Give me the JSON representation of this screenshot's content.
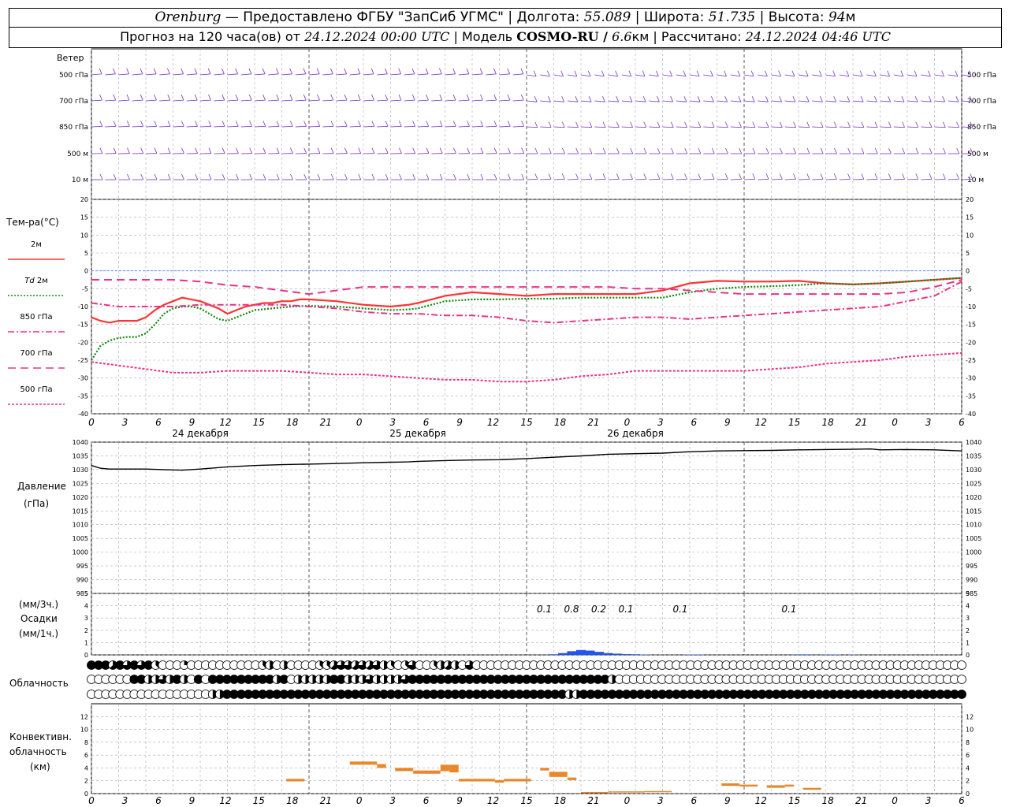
{
  "header": {
    "station": "Orenburg",
    "provider": "Предоставлено ФГБУ \"ЗапСиб УГМС\"",
    "lon_label": "Долгота:",
    "lon": "55.089",
    "lat_label": "Широта:",
    "lat": "51.735",
    "alt_label": "Высота:",
    "alt": "94",
    "alt_unit": "м",
    "forecast_text": "Прогноз на 120 часа(ов) от",
    "forecast_time": "24.12.2024 00:00 UTC",
    "model_label": "Модель",
    "model": "COSMO-RU /",
    "resolution": "6.6",
    "resolution_unit": "км",
    "calc_label": "Рассчитано:",
    "calc_time": "24.12.2024 04:46 UTC"
  },
  "labels": {
    "wind": "Ветер",
    "temp": "Тем-ра(°C)",
    "pressure": "Давление",
    "pressure_unit": "(гПа)",
    "precip_3h": "(мм/3ч.)",
    "precip": "Осадки",
    "precip_1h": "(мм/1ч.)",
    "cloud": "Облачность",
    "conv1": "Конвективн.",
    "conv2": "облачность",
    "conv3": "(км)"
  },
  "wind_levels": [
    "500 гПа",
    "700 гПа",
    "850 гПа",
    "500 м",
    "10 м"
  ],
  "legend": [
    {
      "label": "2м",
      "prefix": "",
      "color": "#ff3333",
      "dash": ""
    },
    {
      "label": "2м",
      "prefix": "Td",
      "color": "#118811",
      "dash": "2,2"
    },
    {
      "label": "850 гПа",
      "prefix": "",
      "color": "#e8338a",
      "dash": "8,3,2,3"
    },
    {
      "label": "700 гПа",
      "prefix": "",
      "color": "#e8338a",
      "dash": "10,6"
    },
    {
      "label": "500 гПа",
      "prefix": "",
      "color": "#e8338a",
      "dash": "3,2"
    }
  ],
  "dates": [
    "24 декабря",
    "25 декабря",
    "26 декабря"
  ],
  "hour_ticks": [
    "0",
    "3",
    "6",
    "9",
    "12",
    "15",
    "18",
    "21",
    "0",
    "3",
    "6",
    "9",
    "12",
    "15",
    "18",
    "21",
    "0",
    "3",
    "6",
    "9",
    "12",
    "15",
    "18",
    "21",
    "0",
    "3",
    "6"
  ],
  "precip_labels": [
    {
      "h": 51,
      "text": "0.1"
    },
    {
      "h": 54,
      "text": "0.8"
    },
    {
      "h": 57,
      "text": "0.2"
    },
    {
      "h": 60,
      "text": "0.1"
    },
    {
      "h": 66,
      "text": "0.1"
    },
    {
      "h": 78,
      "text": "0.1"
    }
  ],
  "colors": {
    "wind": "#7733cc",
    "t2m": "#ff3333",
    "td": "#118811",
    "upper": "#e8338a",
    "pressure": "#000000",
    "precip": "#2255ee",
    "conv": "#e8882a",
    "zero_line": "#5577ff"
  },
  "chart_data": [
    {
      "type": "line",
      "title": "Тем-ра(°C)",
      "x_unit": "hours from 24.12.2024 00:00 UTC",
      "ylim": [
        -40,
        20
      ],
      "yticks": [
        20,
        15,
        10,
        5,
        0,
        -5,
        -10,
        -15,
        -20,
        -25,
        -30,
        -35,
        -40
      ],
      "series": [
        {
          "name": "2м",
          "x": [
            0,
            1,
            2,
            3,
            4,
            5,
            6,
            7,
            8,
            9,
            10,
            11,
            12,
            13,
            14,
            15,
            16,
            17,
            18,
            19,
            20,
            21,
            22,
            23,
            24,
            27,
            30,
            33,
            35,
            36,
            39,
            42,
            45,
            48,
            51,
            54,
            57,
            60,
            63,
            66,
            69,
            72,
            75,
            78,
            81,
            84,
            87,
            90,
            93,
            96
          ],
          "y": [
            -13,
            -14,
            -14.5,
            -14,
            -14,
            -14,
            -13,
            -11,
            -9.5,
            -8.5,
            -7.5,
            -8,
            -8.5,
            -9.5,
            -10.5,
            -12,
            -11,
            -10,
            -9.5,
            -9,
            -9,
            -8.5,
            -8.5,
            -8,
            -8,
            -8.5,
            -9.5,
            -10,
            -9.5,
            -9,
            -7,
            -6,
            -6.5,
            -7,
            -6.5,
            -6.5,
            -6.5,
            -6.5,
            -5.5,
            -3.5,
            -2.8,
            -3,
            -3,
            -2.8,
            -3.5,
            -3.8,
            -3.5,
            -3,
            -2.5,
            -2
          ]
        },
        {
          "name": "Td 2м",
          "x": [
            0,
            1,
            2,
            3,
            4,
            5,
            6,
            7,
            8,
            9,
            10,
            11,
            12,
            13,
            14,
            15,
            16,
            17,
            18,
            20,
            22,
            24,
            27,
            30,
            33,
            35,
            36,
            39,
            42,
            45,
            48,
            51,
            54,
            57,
            60,
            63,
            66,
            69,
            72,
            75,
            78,
            81,
            84,
            87,
            90,
            93,
            96
          ],
          "y": [
            -25,
            -21,
            -19.5,
            -18.8,
            -18.5,
            -18.5,
            -17.5,
            -15,
            -12,
            -10.5,
            -10,
            -10,
            -10.5,
            -12,
            -13.5,
            -14,
            -13,
            -12,
            -11,
            -10.5,
            -10,
            -9.8,
            -10,
            -10.5,
            -11,
            -10.8,
            -10.5,
            -8.5,
            -8,
            -8,
            -7.8,
            -7.8,
            -7.5,
            -7.5,
            -7.5,
            -7.5,
            -6,
            -5,
            -4.5,
            -4.3,
            -4,
            -3.5,
            -3.8,
            -3.5,
            -3,
            -2.5,
            -2
          ]
        },
        {
          "name": "850 гПа",
          "x": [
            0,
            3,
            6,
            9,
            12,
            15,
            18,
            21,
            24,
            27,
            30,
            33,
            36,
            39,
            42,
            45,
            48,
            51,
            54,
            57,
            60,
            63,
            66,
            69,
            72,
            75,
            78,
            81,
            84,
            87,
            90,
            93,
            96
          ],
          "y": [
            -9,
            -10,
            -10,
            -10,
            -9.5,
            -9.5,
            -9.5,
            -9.5,
            -10,
            -10.5,
            -11.5,
            -12,
            -12,
            -12.5,
            -12.5,
            -13,
            -14,
            -14.5,
            -14,
            -13.5,
            -13,
            -13,
            -13.5,
            -13,
            -12.5,
            -12,
            -11.5,
            -11,
            -10.5,
            -10,
            -8.5,
            -7,
            -3
          ]
        },
        {
          "name": "700 гПа",
          "x": [
            0,
            3,
            6,
            9,
            12,
            15,
            18,
            21,
            24,
            27,
            30,
            33,
            36,
            39,
            42,
            45,
            48,
            51,
            54,
            57,
            60,
            63,
            66,
            69,
            72,
            75,
            78,
            81,
            84,
            87,
            90,
            93,
            96
          ],
          "y": [
            -2.5,
            -2.5,
            -2.5,
            -2.5,
            -3,
            -4,
            -4.5,
            -5.5,
            -6.5,
            -5.5,
            -4.5,
            -4.5,
            -4.5,
            -4.5,
            -4.5,
            -4.5,
            -4.5,
            -4.5,
            -4.5,
            -4.5,
            -5,
            -5,
            -5.5,
            -6,
            -6.5,
            -6.5,
            -6.5,
            -6.5,
            -6.5,
            -6.5,
            -6,
            -4.5,
            -2.5
          ]
        },
        {
          "name": "500 гПа",
          "x": [
            0,
            3,
            6,
            9,
            12,
            15,
            18,
            21,
            24,
            27,
            30,
            33,
            36,
            39,
            42,
            45,
            48,
            51,
            54,
            57,
            60,
            63,
            66,
            69,
            72,
            75,
            78,
            81,
            84,
            87,
            90,
            93,
            96
          ],
          "y": [
            -25.5,
            -26.5,
            -27.5,
            -28.5,
            -28.5,
            -28,
            -28,
            -28,
            -28.5,
            -29,
            -29,
            -29.5,
            -30,
            -30.5,
            -30.5,
            -31,
            -31,
            -30.5,
            -29.5,
            -29,
            -28,
            -28,
            -28,
            -28,
            -28,
            -27.5,
            -27,
            -26,
            -25.5,
            -25,
            -24,
            -23.5,
            -23
          ]
        }
      ]
    },
    {
      "type": "line",
      "title": "Давление",
      "ylabel": "(гПа)",
      "ylim": [
        985,
        1040
      ],
      "yticks": [
        1040,
        1035,
        1030,
        1025,
        1020,
        1015,
        1010,
        1005,
        1000,
        995,
        990,
        985
      ],
      "series": [
        {
          "name": "",
          "x": [
            0,
            1,
            2,
            4,
            6,
            8,
            10,
            12,
            15,
            18,
            21,
            24,
            27,
            30,
            33,
            35,
            36,
            39,
            42,
            45,
            48,
            51,
            54,
            57,
            60,
            63,
            66,
            69,
            72,
            75,
            78,
            81,
            84,
            86,
            87,
            90,
            93,
            96
          ],
          "y": [
            1031.5,
            1030.5,
            1030.2,
            1030.2,
            1030.2,
            1030,
            1029.8,
            1030.2,
            1031,
            1031.5,
            1031.8,
            1032,
            1032.2,
            1032.5,
            1032.7,
            1032.8,
            1033,
            1033.3,
            1033.5,
            1033.6,
            1034,
            1034.5,
            1035,
            1035.6,
            1035.8,
            1036,
            1036.5,
            1036.8,
            1036.9,
            1037,
            1037.2,
            1037.3,
            1037.4,
            1037.5,
            1037.2,
            1037.3,
            1037.2,
            1036.8
          ]
        }
      ]
    },
    {
      "type": "bar",
      "title": "Осадки",
      "ylabel": "(мм/1ч.)",
      "ylim": [
        0,
        5
      ],
      "yticks": [
        5,
        4,
        3,
        2,
        1,
        0
      ],
      "x": [
        51,
        52,
        53,
        54,
        55,
        56,
        57,
        58,
        59,
        60,
        61,
        66,
        67,
        78,
        79,
        81,
        82,
        84
      ],
      "values": [
        0.05,
        0.15,
        0.3,
        0.4,
        0.35,
        0.25,
        0.15,
        0.1,
        0.06,
        0.05,
        0.03,
        0.03,
        0.03,
        0.04,
        0.04,
        0.02,
        0.03,
        0.02
      ]
    },
    {
      "type": "table",
      "title": "Облачность",
      "note": "cloud fraction per hour (0..8) for three layers",
      "rows": [
        [
          8,
          8,
          8,
          5,
          8,
          6,
          8,
          6,
          8,
          3,
          0,
          0,
          0,
          2,
          0,
          0,
          0,
          0,
          0,
          0,
          0,
          0,
          0,
          0,
          3,
          4,
          0,
          4,
          0,
          0,
          0,
          0,
          3,
          3,
          5,
          6,
          6,
          5,
          6,
          5,
          6,
          4,
          3,
          0,
          3,
          6,
          0,
          0,
          3,
          4,
          5,
          4,
          0,
          6,
          0,
          0,
          0,
          0,
          0,
          0,
          0,
          0,
          0,
          0,
          0,
          0,
          0,
          0,
          0,
          0,
          0,
          0,
          0,
          0,
          0,
          0,
          0,
          0,
          0,
          0,
          0,
          0,
          0,
          0,
          0,
          0,
          0,
          0,
          0,
          0,
          0,
          0,
          0,
          0,
          0,
          0,
          0,
          0,
          0,
          0,
          0,
          0,
          0,
          0,
          0,
          0,
          0,
          0,
          0,
          0,
          0,
          0,
          0,
          0,
          0,
          0,
          0,
          0,
          0,
          0,
          0,
          0,
          0
        ],
        [
          0,
          0,
          0,
          0,
          0,
          0,
          8,
          8,
          4,
          4,
          6,
          4,
          8,
          4,
          0,
          8,
          0,
          8,
          8,
          8,
          8,
          8,
          8,
          8,
          8,
          8,
          4,
          8,
          0,
          4,
          4,
          4,
          4,
          4,
          8,
          8,
          4,
          4,
          4,
          6,
          4,
          4,
          4,
          4,
          6,
          8,
          8,
          8,
          8,
          8,
          8,
          8,
          8,
          8,
          8,
          8,
          8,
          8,
          8,
          8,
          8,
          8,
          8,
          8,
          8,
          8,
          8,
          8,
          8,
          8,
          8,
          8,
          8,
          4,
          0,
          0,
          0,
          0,
          0,
          0,
          0,
          0,
          0,
          0,
          0,
          0,
          0,
          0,
          0,
          0,
          0,
          0,
          0,
          0,
          0,
          0,
          0,
          0,
          0,
          0,
          0,
          0,
          0,
          0,
          0,
          0,
          0,
          0,
          0,
          0,
          0,
          0,
          0,
          0,
          0,
          0,
          0,
          0,
          0,
          0,
          0,
          0,
          0
        ],
        [
          0,
          0,
          0,
          0,
          0,
          0,
          0,
          0,
          0,
          0,
          0,
          0,
          0,
          0,
          0,
          0,
          0,
          4,
          4,
          8,
          8,
          8,
          8,
          8,
          8,
          8,
          8,
          8,
          8,
          8,
          8,
          8,
          8,
          8,
          8,
          8,
          8,
          8,
          8,
          8,
          8,
          8,
          8,
          8,
          8,
          8,
          8,
          8,
          8,
          8,
          8,
          8,
          8,
          8,
          8,
          8,
          8,
          8,
          8,
          8,
          8,
          8,
          8,
          8,
          8,
          8,
          8,
          4,
          4,
          8,
          8,
          8,
          8,
          8,
          8,
          8,
          8,
          8,
          8,
          8,
          8,
          8,
          8,
          8,
          8,
          8,
          8,
          8,
          8,
          8,
          8,
          8,
          8,
          8,
          8,
          8,
          8,
          8,
          8,
          8,
          8,
          8,
          8,
          8,
          8,
          8,
          8,
          8,
          8,
          8,
          8,
          8,
          8,
          8,
          8,
          8,
          8,
          8,
          8,
          8,
          8,
          8,
          8
        ]
      ]
    },
    {
      "type": "bar",
      "title": "Конвективн. облачность",
      "ylabel": "(км)",
      "ylim": [
        0,
        14
      ],
      "yticks": [
        12,
        10,
        8,
        6,
        4,
        2,
        0
      ],
      "note": "cloud layer base/top (km) per interval of hours",
      "bars": [
        {
          "x0": 21.5,
          "x1": 23.5,
          "y0": 1.9,
          "y1": 2.3
        },
        {
          "x0": 28.5,
          "x1": 31.5,
          "y0": 4.5,
          "y1": 5
        },
        {
          "x0": 31.5,
          "x1": 32.5,
          "y0": 4,
          "y1": 4.6
        },
        {
          "x0": 33.5,
          "x1": 35.5,
          "y0": 3.5,
          "y1": 4
        },
        {
          "x0": 35.5,
          "x1": 38.5,
          "y0": 3.1,
          "y1": 3.6
        },
        {
          "x0": 38.5,
          "x1": 39.5,
          "y0": 3.5,
          "y1": 4.5
        },
        {
          "x0": 39.5,
          "x1": 40.5,
          "y0": 3.3,
          "y1": 4.5
        },
        {
          "x0": 40.5,
          "x1": 44.5,
          "y0": 1.9,
          "y1": 2.3
        },
        {
          "x0": 44.5,
          "x1": 45.5,
          "y0": 1.7,
          "y1": 2.1
        },
        {
          "x0": 45.5,
          "x1": 48.5,
          "y0": 1.9,
          "y1": 2.3
        },
        {
          "x0": 49.5,
          "x1": 50.5,
          "y0": 3.6,
          "y1": 4
        },
        {
          "x0": 50.5,
          "x1": 52.5,
          "y0": 2.6,
          "y1": 3.4
        },
        {
          "x0": 52.5,
          "x1": 53.5,
          "y0": 2.1,
          "y1": 2.5
        },
        {
          "x0": 54,
          "x1": 57,
          "y0": 0.1,
          "y1": 0.25
        },
        {
          "x0": 57,
          "x1": 61,
          "y0": 0.2,
          "y1": 0.35
        },
        {
          "x0": 61,
          "x1": 64,
          "y0": 0.25,
          "y1": 0.4
        },
        {
          "x0": 69.5,
          "x1": 71.5,
          "y0": 1.2,
          "y1": 1.6
        },
        {
          "x0": 71.5,
          "x1": 73.5,
          "y0": 1.1,
          "y1": 1.4
        },
        {
          "x0": 74.5,
          "x1": 76.5,
          "y0": 0.9,
          "y1": 1.3
        },
        {
          "x0": 76.5,
          "x1": 77.5,
          "y0": 1.1,
          "y1": 1.4
        },
        {
          "x0": 78.5,
          "x1": 80.5,
          "y0": 0.6,
          "y1": 0.9
        }
      ]
    }
  ]
}
